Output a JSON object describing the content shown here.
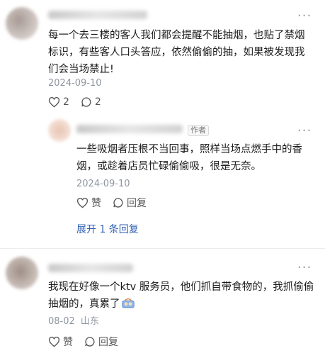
{
  "comments": [
    {
      "text": "每一个去三楼的客人我们都会提醒不能抽烟，也贴了禁烟标识，有些客人口头答应，依然偷偷的抽，如果被发现我们会当场禁止!",
      "date": "2024-09-10",
      "like_count": "2",
      "reply_count": "2",
      "more_icon": "more-dots-icon"
    },
    {
      "author_tag": "作者",
      "text": "一些吸烟者压根不当回事，照样当场点燃手中的香烟，或趁着店员忙碌偷偷吸，很是无奈。",
      "date": "2024-09-10",
      "like_label": "赞",
      "reply_label": "回复",
      "expand_label": "展开 1 条回复"
    },
    {
      "text": "我现在好像一个ktv 服务员，他们抓自带食物的，我抓偷偷抽烟的，真累了",
      "date": "08-02",
      "location": "山东",
      "like_label": "赞",
      "reply_label": "回复",
      "emoji_icon": "tired-emoji-icon"
    }
  ],
  "colors": {
    "link": "#2d5fb4",
    "meta": "#8f96a0",
    "text": "#1b1b1b"
  }
}
